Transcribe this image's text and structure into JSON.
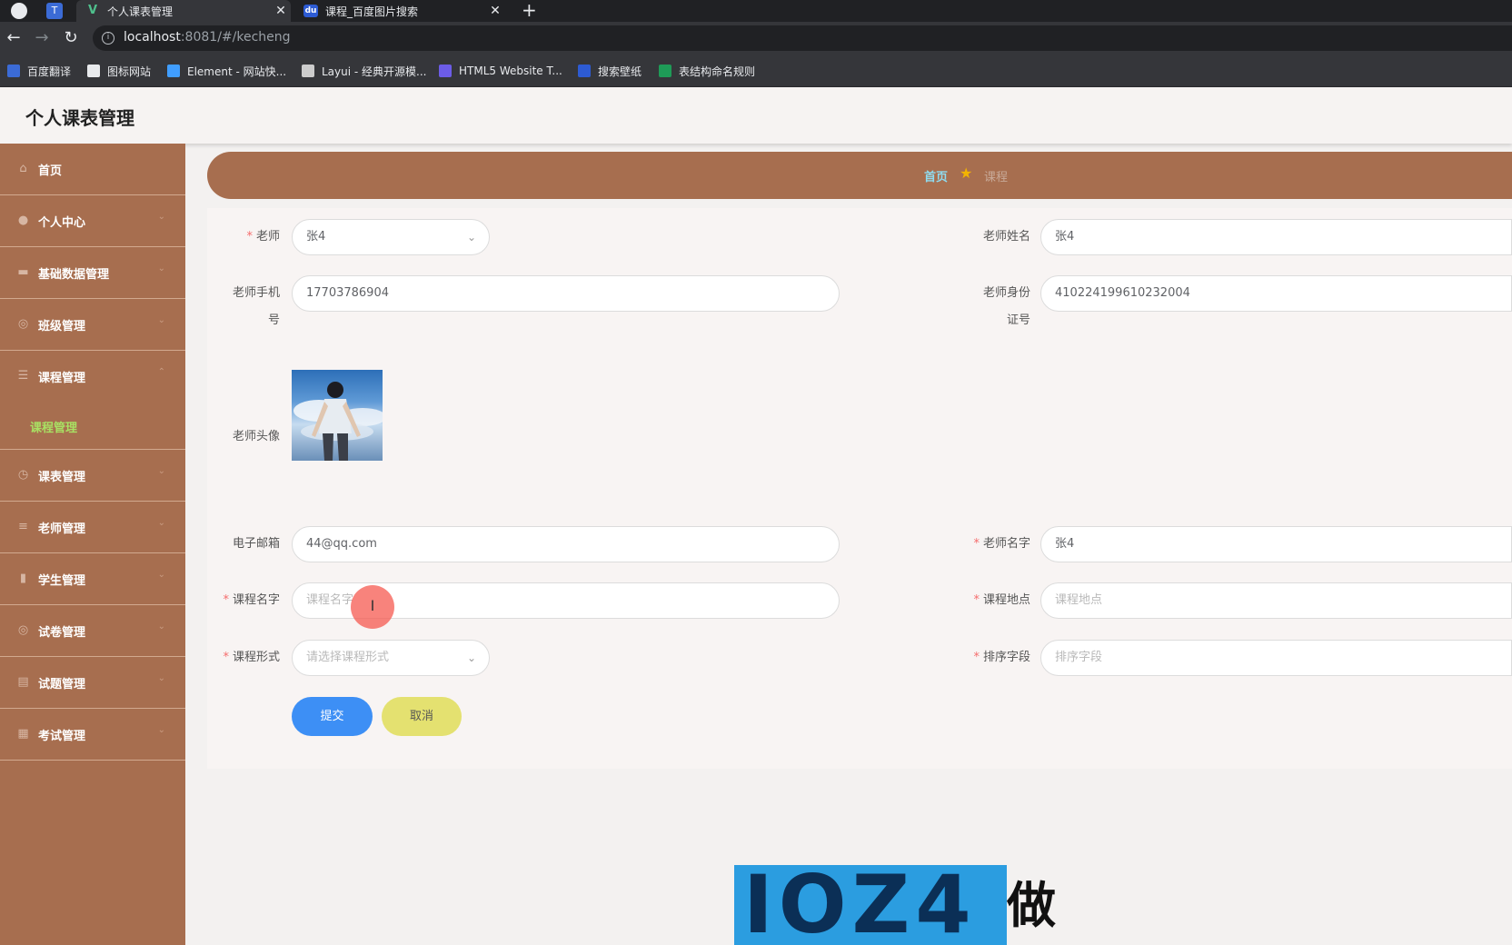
{
  "browser": {
    "tabs": [
      {
        "title": "个人课表管理",
        "close": "✕"
      },
      {
        "title": "课程_百度图片搜索",
        "close": "✕"
      }
    ],
    "new_tab": "+",
    "address": {
      "host": "localhost",
      "path": ":8081/#/kecheng"
    },
    "bookmarks": [
      {
        "label": "百度翻译",
        "color": "#3b6bd6"
      },
      {
        "label": "图标网站",
        "color": "#e8eaed"
      },
      {
        "label": "Element - 网站快...",
        "color": "#409eff"
      },
      {
        "label": "Layui - 经典开源模...",
        "color": "#cccccc"
      },
      {
        "label": "HTML5 Website T...",
        "color": "#6c5ce7"
      },
      {
        "label": "搜索壁纸",
        "color": "#2d5bd3"
      },
      {
        "label": "表结构命名规则",
        "color": "#1e9b57"
      }
    ]
  },
  "app": {
    "title": "个人课表管理"
  },
  "sidebar": {
    "items": [
      {
        "label": "首页",
        "icon": "home-icon"
      },
      {
        "label": "个人中心",
        "icon": "user-icon"
      },
      {
        "label": "基础数据管理",
        "icon": "monitor-icon"
      },
      {
        "label": "班级管理",
        "icon": "circle-icon"
      },
      {
        "label": "课程管理",
        "icon": "list-icon"
      },
      {
        "label": "课表管理",
        "icon": "clock-icon"
      },
      {
        "label": "老师管理",
        "icon": "menu-icon"
      },
      {
        "label": "学生管理",
        "icon": "bar-chart-icon"
      },
      {
        "label": "试卷管理",
        "icon": "circle-icon"
      },
      {
        "label": "试题管理",
        "icon": "briefcase-icon"
      },
      {
        "label": "考试管理",
        "icon": "grid-icon"
      }
    ],
    "submenu": {
      "label": "课程管理"
    }
  },
  "breadcrumb": {
    "home": "首页",
    "current": "课程"
  },
  "form": {
    "teacher": {
      "label": "老师",
      "value": "张4"
    },
    "teacher_name": {
      "label": "老师姓名",
      "value": "张4"
    },
    "teacher_phone": {
      "label_line1": "老师手机",
      "label_line2": "号",
      "value": "17703786904"
    },
    "teacher_id": {
      "label_line1": "老师身份",
      "label_line2": "证号",
      "value": "410224199610232004"
    },
    "teacher_avatar": {
      "label": "老师头像"
    },
    "email": {
      "label": "电子邮箱",
      "value": "44@qq.com"
    },
    "teacher_name2": {
      "label": "老师名字",
      "value": "张4"
    },
    "course_name": {
      "label": "课程名字",
      "placeholder": "课程名字"
    },
    "course_place": {
      "label": "课程地点",
      "placeholder": "课程地点"
    },
    "course_form": {
      "label": "课程形式",
      "placeholder": "请选择课程形式"
    },
    "sort_field": {
      "label": "排序字段",
      "placeholder": "排序字段"
    },
    "submit_label": "提交",
    "cancel_label": "取消"
  },
  "watermark": {
    "text": "IOZ4",
    "suffix": "做"
  },
  "colors": {
    "sidebar": "#a76e4f",
    "active_submenu": "#a8e063",
    "submit": "#3d8ff5",
    "cancel": "#e4e170"
  }
}
